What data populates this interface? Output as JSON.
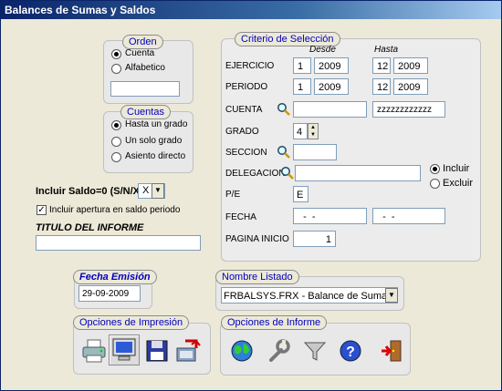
{
  "window": {
    "title": "Balances de Sumas y Saldos"
  },
  "orden": {
    "legend": "Orden",
    "options": [
      "Cuenta",
      "Alfabetico"
    ],
    "selected": 0,
    "field_value": ""
  },
  "cuentas": {
    "legend": "Cuentas",
    "options": [
      "Hasta un grado",
      "Un solo grado",
      "Asiento directo"
    ],
    "selected": 0
  },
  "incluir_saldo": {
    "label": "Incluir Saldo=0 (S/N/X)",
    "value": "X"
  },
  "incluir_apertura": {
    "label": "Incluir apertura en saldo periodo",
    "checked": true
  },
  "titulo": {
    "label": "TITULO DEL INFORME",
    "value": ""
  },
  "criterio": {
    "legend": "Criterio de Selección",
    "desde_label": "Desde",
    "hasta_label": "Hasta",
    "ejercicio": {
      "label": "EJERCICIO",
      "desde_a": "1",
      "desde_b": "2009",
      "hasta_a": "12",
      "hasta_b": "2009"
    },
    "periodo": {
      "label": "PERIODO",
      "desde_a": "1",
      "desde_b": "2009",
      "hasta_a": "12",
      "hasta_b": "2009"
    },
    "cuenta": {
      "label": "CUENTA",
      "desde": "",
      "hasta": "zzzzzzzzzzzz"
    },
    "grado": {
      "label": "GRADO",
      "value": "4"
    },
    "seccion": {
      "label": "SECCION",
      "value": ""
    },
    "delegacion": {
      "label": "DELEGACION",
      "value": ""
    },
    "incl_excl": {
      "options": [
        "Incluir",
        "Excluir"
      ],
      "selected": 0
    },
    "pe": {
      "label": "P/E",
      "value": "E"
    },
    "fecha": {
      "label": "FECHA",
      "desde": "  -  -",
      "hasta": "  -  -"
    },
    "pagina": {
      "label": "PAGINA INICIO",
      "value": "1"
    }
  },
  "fecha_emision": {
    "legend": "Fecha Emisión",
    "value": "29-09-2009"
  },
  "nombre_listado": {
    "legend": "Nombre Listado",
    "value": "FRBALSYS.FRX - Balance de Suma"
  },
  "opciones_impresion": {
    "legend": "Opciones de Impresión",
    "buttons": [
      "printer-icon",
      "monitor-icon",
      "floppy-disk-icon",
      "export-icon"
    ]
  },
  "opciones_informe": {
    "legend": "Opciones de Informe",
    "buttons": [
      "globe-icon",
      "wrench-icon",
      "filter-funnel-icon",
      "help-icon",
      "exit-door-icon"
    ]
  }
}
